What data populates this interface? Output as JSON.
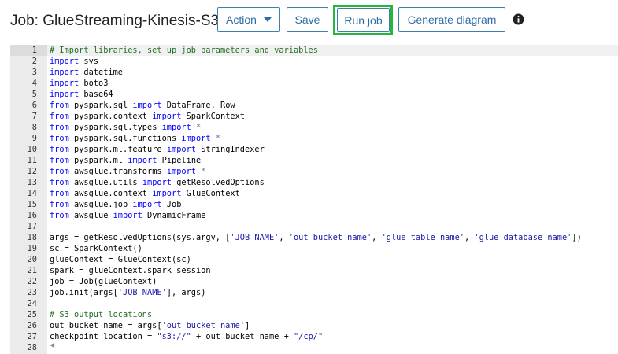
{
  "header": {
    "title": "Job: GlueStreaming-Kinesis-S3",
    "buttons": {
      "action": "Action",
      "save": "Save",
      "run_job": "Run job",
      "generate_diagram": "Generate diagram"
    },
    "info_icon": "info-icon"
  },
  "colors": {
    "button_border": "#3f7fae",
    "button_text": "#2e6da4",
    "highlight": "#24b63f",
    "keyword": "#0000ff",
    "string": "#1a1aa6",
    "comment": "#236e24",
    "gutter": "#ebebeb"
  },
  "editor": {
    "active_line": 1,
    "lines": [
      {
        "n": "1",
        "tokens": [
          [
            "cm",
            "# Import libraries, set up job parameters and variables"
          ]
        ]
      },
      {
        "n": "2",
        "tokens": [
          [
            "kw",
            "import"
          ],
          [
            "",
            " sys"
          ]
        ]
      },
      {
        "n": "3",
        "tokens": [
          [
            "kw",
            "import"
          ],
          [
            "",
            " datetime"
          ]
        ]
      },
      {
        "n": "4",
        "tokens": [
          [
            "kw",
            "import"
          ],
          [
            "",
            " boto3"
          ]
        ]
      },
      {
        "n": "5",
        "tokens": [
          [
            "kw",
            "import"
          ],
          [
            "",
            " base64"
          ]
        ]
      },
      {
        "n": "6",
        "tokens": [
          [
            "kw",
            "from"
          ],
          [
            "",
            " pyspark.sql "
          ],
          [
            "kw",
            "import"
          ],
          [
            "",
            " DataFrame, Row"
          ]
        ]
      },
      {
        "n": "7",
        "tokens": [
          [
            "kw",
            "from"
          ],
          [
            "",
            " pyspark.context "
          ],
          [
            "kw",
            "import"
          ],
          [
            "",
            " SparkContext"
          ]
        ]
      },
      {
        "n": "8",
        "tokens": [
          [
            "kw",
            "from"
          ],
          [
            "",
            " pyspark.sql.types "
          ],
          [
            "kw",
            "import"
          ],
          [
            "op",
            " *"
          ]
        ]
      },
      {
        "n": "9",
        "tokens": [
          [
            "kw",
            "from"
          ],
          [
            "",
            " pyspark.sql.functions "
          ],
          [
            "kw",
            "import"
          ],
          [
            "op",
            " *"
          ]
        ]
      },
      {
        "n": "10",
        "tokens": [
          [
            "kw",
            "from"
          ],
          [
            "",
            " pyspark.ml.feature "
          ],
          [
            "kw",
            "import"
          ],
          [
            "",
            " StringIndexer"
          ]
        ]
      },
      {
        "n": "11",
        "tokens": [
          [
            "kw",
            "from"
          ],
          [
            "",
            " pyspark.ml "
          ],
          [
            "kw",
            "import"
          ],
          [
            "",
            " Pipeline"
          ]
        ]
      },
      {
        "n": "12",
        "tokens": [
          [
            "kw",
            "from"
          ],
          [
            "",
            " awsglue.transforms "
          ],
          [
            "kw",
            "import"
          ],
          [
            "op",
            " *"
          ]
        ]
      },
      {
        "n": "13",
        "tokens": [
          [
            "kw",
            "from"
          ],
          [
            "",
            " awsglue.utils "
          ],
          [
            "kw",
            "import"
          ],
          [
            "",
            " getResolvedOptions"
          ]
        ]
      },
      {
        "n": "14",
        "tokens": [
          [
            "kw",
            "from"
          ],
          [
            "",
            " awsglue.context "
          ],
          [
            "kw",
            "import"
          ],
          [
            "",
            " GlueContext"
          ]
        ]
      },
      {
        "n": "15",
        "tokens": [
          [
            "kw",
            "from"
          ],
          [
            "",
            " awsglue.job "
          ],
          [
            "kw",
            "import"
          ],
          [
            "",
            " Job"
          ]
        ]
      },
      {
        "n": "16",
        "tokens": [
          [
            "kw",
            "from"
          ],
          [
            "",
            " awsglue "
          ],
          [
            "kw",
            "import"
          ],
          [
            "",
            " DynamicFrame"
          ]
        ]
      },
      {
        "n": "17",
        "tokens": []
      },
      {
        "n": "18",
        "tokens": [
          [
            "",
            "args = getResolvedOptions(sys.argv, ["
          ],
          [
            "str",
            "'JOB_NAME'"
          ],
          [
            "",
            ", "
          ],
          [
            "str",
            "'out_bucket_name'"
          ],
          [
            "",
            ", "
          ],
          [
            "str",
            "'glue_table_name'"
          ],
          [
            "",
            ", "
          ],
          [
            "str",
            "'glue_database_name'"
          ],
          [
            "",
            "])"
          ]
        ]
      },
      {
        "n": "19",
        "tokens": [
          [
            "",
            "sc = SparkContext()"
          ]
        ]
      },
      {
        "n": "20",
        "tokens": [
          [
            "",
            "glueContext = GlueContext(sc)"
          ]
        ]
      },
      {
        "n": "21",
        "tokens": [
          [
            "",
            "spark = glueContext.spark_session"
          ]
        ]
      },
      {
        "n": "22",
        "tokens": [
          [
            "",
            "job = Job(glueContext)"
          ]
        ]
      },
      {
        "n": "23",
        "tokens": [
          [
            "",
            "job.init(args["
          ],
          [
            "str",
            "'JOB_NAME'"
          ],
          [
            "",
            "], args)"
          ]
        ]
      },
      {
        "n": "24",
        "tokens": []
      },
      {
        "n": "25",
        "tokens": [
          [
            "cm",
            "# S3 output locations"
          ]
        ]
      },
      {
        "n": "26",
        "tokens": [
          [
            "",
            "out_bucket_name = args["
          ],
          [
            "str",
            "'out_bucket_name'"
          ],
          [
            "",
            "]"
          ]
        ]
      },
      {
        "n": "27",
        "tokens": [
          [
            "",
            "checkpoint_location = "
          ],
          [
            "str",
            "\"s3://\""
          ],
          [
            "",
            " + out_bucket_name + "
          ],
          [
            "str",
            "\"/cp/\""
          ]
        ]
      },
      {
        "n": "28",
        "tokens": []
      }
    ]
  }
}
